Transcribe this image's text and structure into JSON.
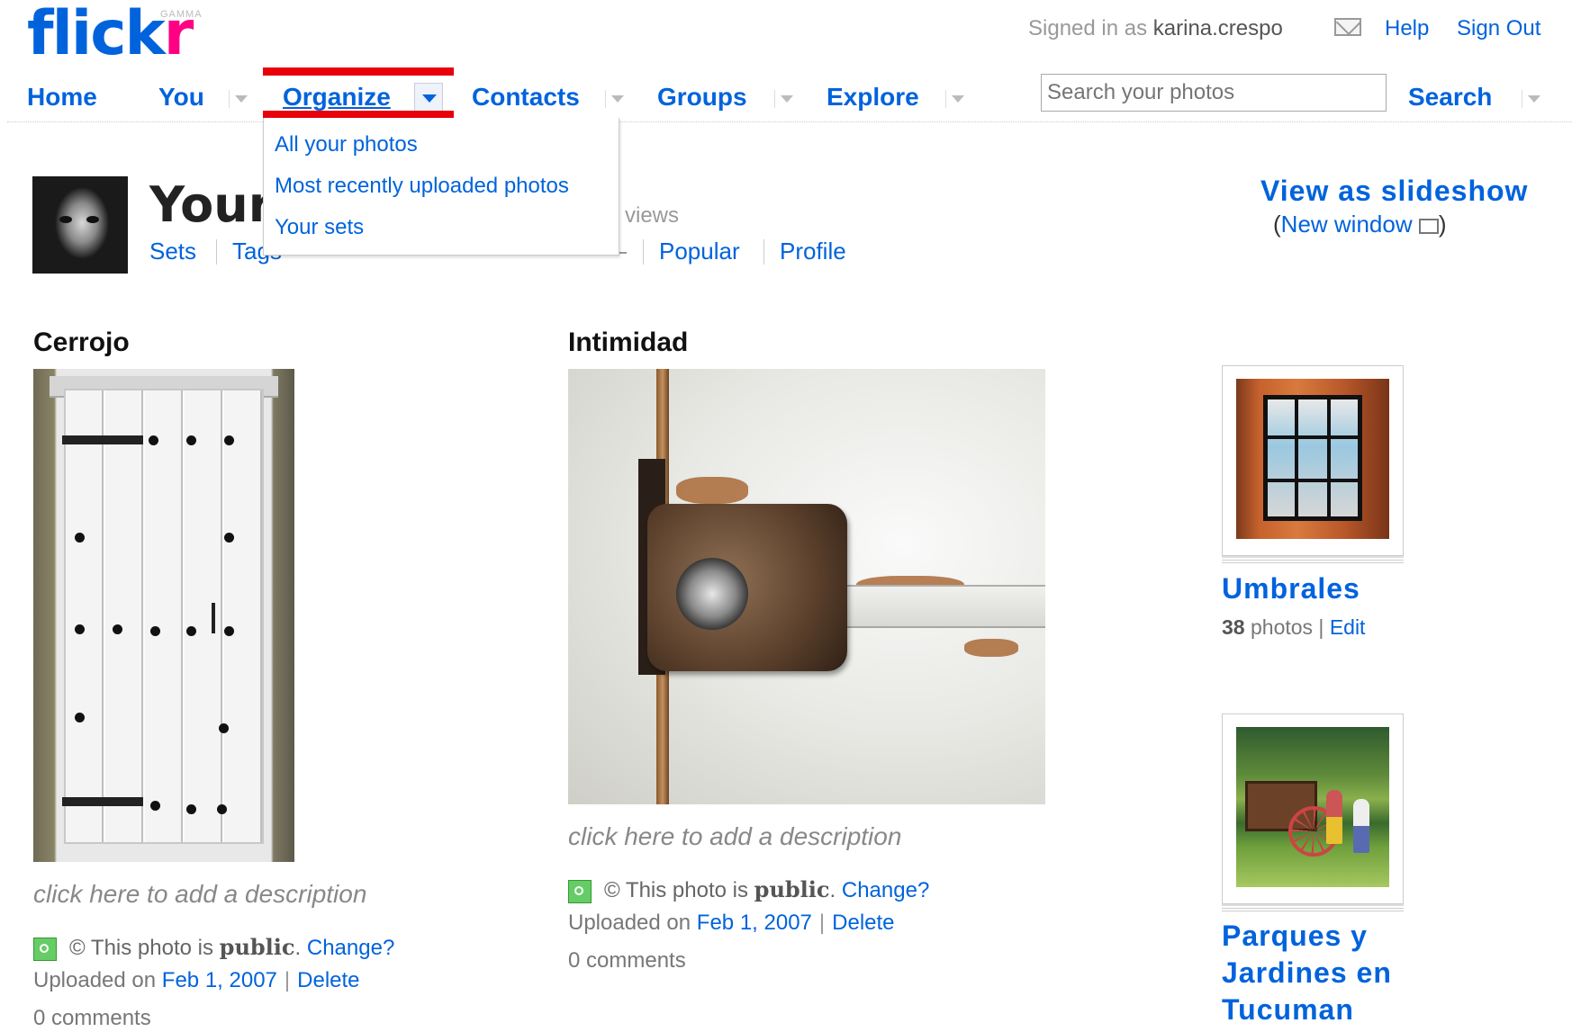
{
  "header": {
    "logo_text_blue": "flick",
    "logo_text_pink": "r",
    "logo_badge": "GAMMA",
    "signed_in_prefix": "Signed in as",
    "signed_in_user": "karina.crespo",
    "mail_icon": "envelope-icon",
    "help": "Help",
    "sign_out": "Sign Out"
  },
  "nav": {
    "items": [
      {
        "label": "Home"
      },
      {
        "label": "You"
      },
      {
        "label": "Organize"
      },
      {
        "label": "Contacts"
      },
      {
        "label": "Groups"
      },
      {
        "label": "Explore"
      }
    ],
    "search_placeholder": "Search your photos",
    "search_button": "Search",
    "highlight_color": "#e8000b"
  },
  "organize_menu": {
    "items": [
      {
        "label": "All your photos"
      },
      {
        "label": "Most recently uploaded photos"
      },
      {
        "label": "Your sets"
      }
    ]
  },
  "profile": {
    "title": "Your",
    "views_suffix": "views",
    "subnav": [
      {
        "label": "Sets"
      },
      {
        "label": "Tags"
      },
      {
        "label": "Popular"
      },
      {
        "label": "Profile"
      }
    ],
    "slideshow": "View as slideshow",
    "new_window_open": "(",
    "new_window": "New window",
    "new_window_close": ")"
  },
  "photos": [
    {
      "title": "Cerrojo",
      "description_placeholder": "click here to add a description",
      "privacy_prefix": "This photo is",
      "privacy_value": "public",
      "privacy_change": "Change?",
      "uploaded_prefix": "Uploaded on",
      "uploaded_date": "Feb 1, 2007",
      "delete": "Delete",
      "comments": "0 comments"
    },
    {
      "title": "Intimidad",
      "description_placeholder": "click here to add a description",
      "privacy_prefix": "This photo is",
      "privacy_value": "public",
      "privacy_change": "Change?",
      "uploaded_prefix": "Uploaded on",
      "uploaded_date": "Feb 1, 2007",
      "delete": "Delete",
      "comments": "0 comments"
    }
  ],
  "sets": [
    {
      "title": "Umbrales",
      "count": "38",
      "count_suffix": "photos",
      "edit": "Edit"
    },
    {
      "title_lines": [
        "Parques y",
        "Jardines en",
        "Tucuman"
      ]
    }
  ],
  "colors": {
    "link": "#0063dc",
    "logo_pink": "#ff0084"
  }
}
